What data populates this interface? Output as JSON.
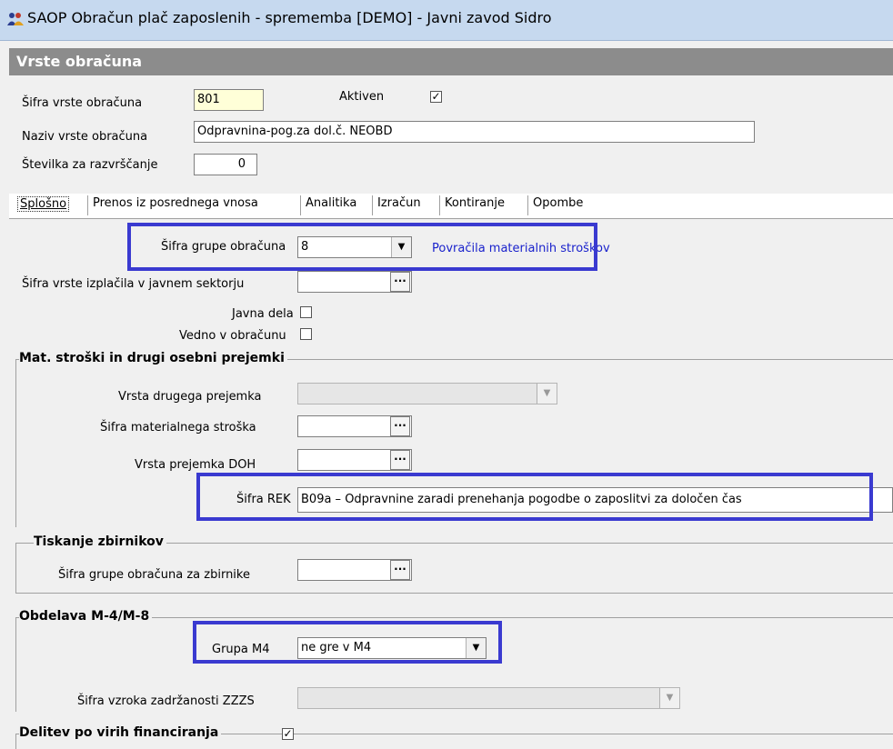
{
  "window": {
    "title": "SAOP Obračun plač zaposlenih - sprememba [DEMO] - Javni zavod Sidro"
  },
  "panel": {
    "title": "Vrste obračuna"
  },
  "header_fields": {
    "sifra_label": "Šifra vrste obračuna",
    "sifra_value": "801",
    "aktiven_label": "Aktiven",
    "aktiven_checked": "✓",
    "naziv_label": "Naziv vrste obračuna",
    "naziv_value": "Odpravnina-pog.za dol.č. NEOBD",
    "stevilka_label": "Številka  za razvrščanje",
    "stevilka_value": "0"
  },
  "tabs": [
    {
      "label": "Splošno"
    },
    {
      "label": "Prenos iz posrednega vnosa"
    },
    {
      "label": "Analitika"
    },
    {
      "label": "Izračun"
    },
    {
      "label": "Kontiranje"
    },
    {
      "label": "Opombe"
    }
  ],
  "general": {
    "grupa_label": "Šifra grupe obračuna",
    "grupa_value": "8",
    "grupa_desc": "Povračila materialnih stroškov",
    "izplacilo_label": "Šifra vrste izplačila v javnem sektorju",
    "izplacilo_value": "",
    "javna_dela_label": "Javna dela",
    "vedno_label": "Vedno v obračunu"
  },
  "mat_stroski": {
    "title": "Mat. stroški in drugi osebni prejemki",
    "vrsta_drugega_label": "Vrsta drugega prejemka",
    "sifra_mat_label": "Šifra materialnega stroška",
    "vrsta_doh_label": "Vrsta prejemka DOH",
    "sifra_rek_label": "Šifra REK",
    "sifra_rek_value": "B09a – Odpravnine zaradi prenehanja pogodbe o zaposlitvi za določen čas"
  },
  "tiskanje": {
    "title": "Tiskanje zbirnikov",
    "grupa_zbirnike_label": "Šifra grupe obračuna za zbirnike"
  },
  "obdelava": {
    "title": "Obdelava M-4/M-8",
    "grupa_m4_label": "Grupa M4",
    "grupa_m4_value": "ne gre v M4",
    "vzrok_label": "Šifra vzroka zadržanosti ZZZS"
  },
  "delitev": {
    "title": "Delitev po virih financiranja",
    "checked": "✓"
  },
  "colors": {
    "highlight": "#3a3ad0",
    "link": "#1a22cc",
    "header_bg": "#8c8c8c",
    "yellow_input": "#ffffd8"
  },
  "icons": {
    "app": "people-icon",
    "ellipsis": "ellipsis-icon",
    "dropdown": "chevron-down-icon"
  }
}
